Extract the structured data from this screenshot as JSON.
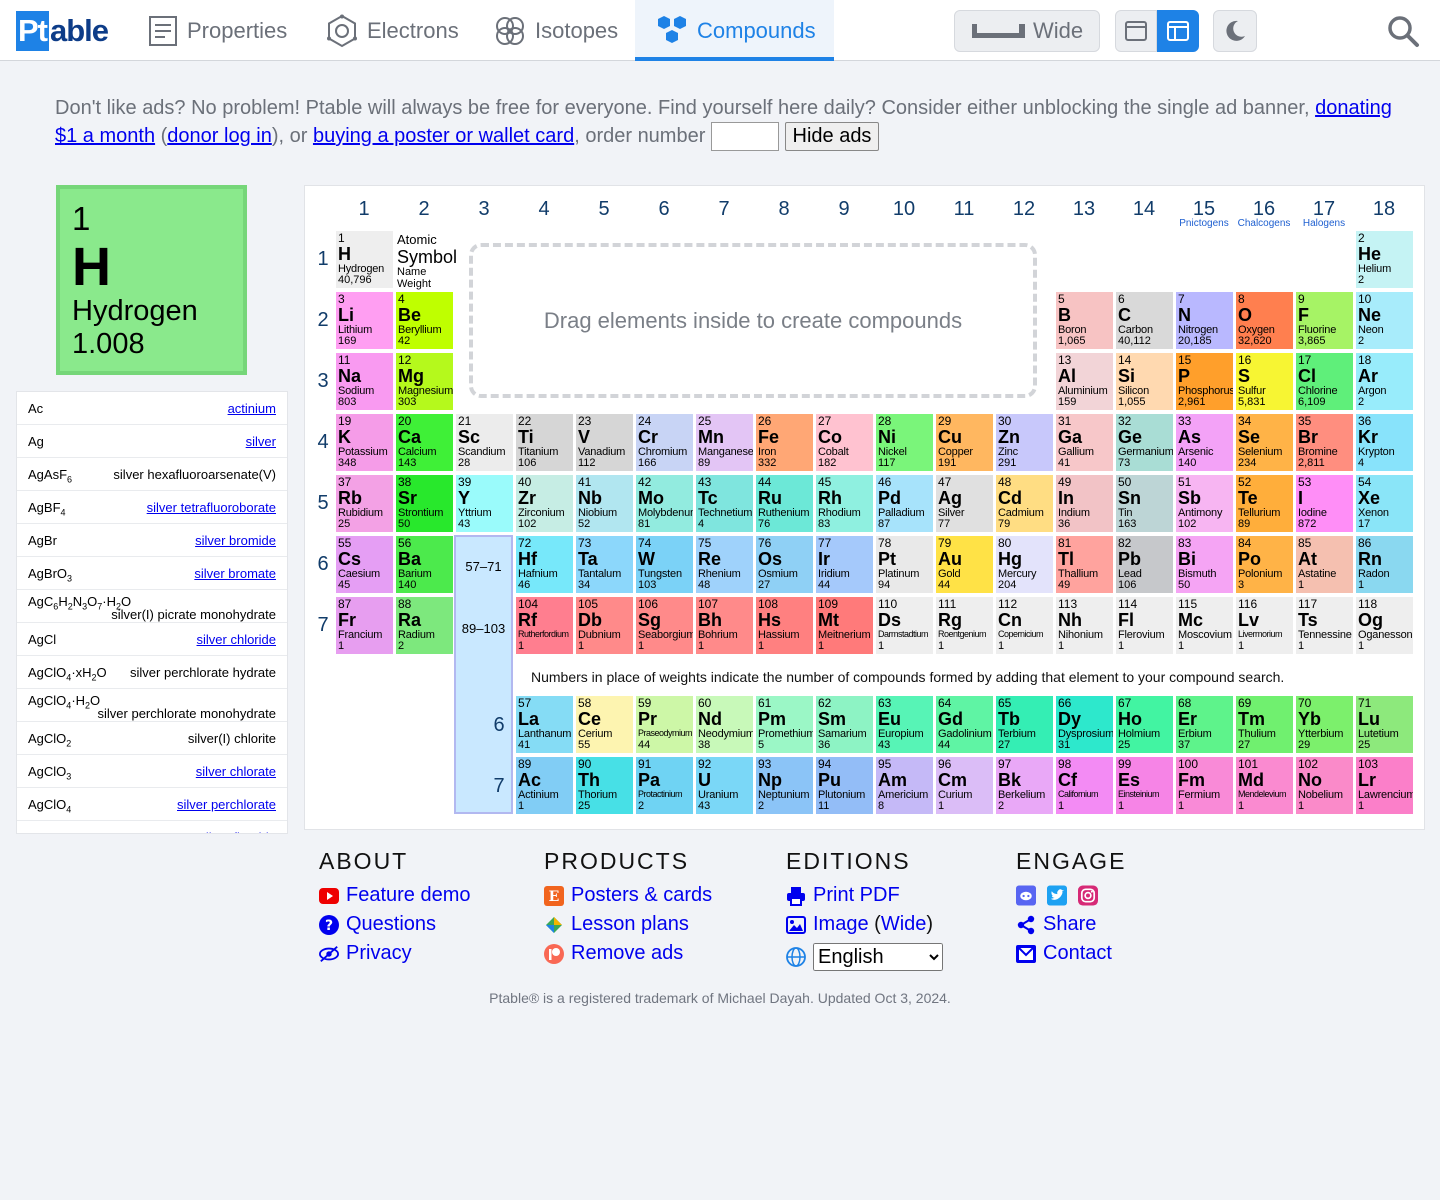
{
  "nav": {
    "logo_a": "Pt",
    "logo_b": "able",
    "tabs": [
      {
        "label": "Properties"
      },
      {
        "label": "Electrons"
      },
      {
        "label": "Isotopes"
      },
      {
        "label": "Compounds"
      }
    ],
    "wide_label": "Wide"
  },
  "ads": {
    "text_a": "Don't like ads? No problem! Ptable will always be free for everyone. Find yourself here daily? Consider either unblocking the single ad banner, ",
    "link_donate": "donating $1 a month",
    "text_b": " (",
    "link_login": "donor log in",
    "text_c": "), or ",
    "link_poster": "buying a poster or wallet card",
    "text_d": ", order number ",
    "hide_label": "Hide ads"
  },
  "selected": {
    "number": "1",
    "symbol": "H",
    "name": "Hydrogen",
    "weight": "1.008"
  },
  "compounds": [
    {
      "formula": "Ac",
      "name": "actinium",
      "link": true
    },
    {
      "formula": "Ag",
      "name": "silver",
      "link": true
    },
    {
      "formula": "AgAsF<sub>6</sub>",
      "name": "silver hexafluoroarsenate(V)",
      "link": false
    },
    {
      "formula": "AgBF<sub>4</sub>",
      "name": "silver tetrafluoroborate",
      "link": true
    },
    {
      "formula": "AgBr",
      "name": "silver bromide",
      "link": true
    },
    {
      "formula": "AgBrO<sub>3</sub>",
      "name": "silver bromate",
      "link": true
    },
    {
      "formula": "AgC<sub>6</sub>H<sub>2</sub>N<sub>3</sub>O<sub>7</sub>·H<sub>2</sub>O",
      "name": "silver(I) picrate monohydrate",
      "link": false,
      "two": true
    },
    {
      "formula": "AgCl",
      "name": "silver chloride",
      "link": true
    },
    {
      "formula": "AgClO<sub>4</sub>·xH<sub>2</sub>O",
      "name": "silver perchlorate hydrate",
      "link": false
    },
    {
      "formula": "AgClO<sub>4</sub>·H<sub>2</sub>O",
      "name": "silver perchlorate monohydrate",
      "link": false,
      "two": true
    },
    {
      "formula": "AgClO<sub>2</sub>",
      "name": "silver(I) chlorite",
      "link": false
    },
    {
      "formula": "AgClO<sub>3</sub>",
      "name": "silver chlorate",
      "link": true
    },
    {
      "formula": "AgClO<sub>4</sub>",
      "name": "silver perchlorate",
      "link": true
    },
    {
      "formula": "AgF",
      "name": "silver fluoride",
      "link": true
    }
  ],
  "table": {
    "groups": [
      "1",
      "2",
      "3",
      "4",
      "5",
      "6",
      "7",
      "8",
      "9",
      "10",
      "11",
      "12",
      "13",
      "14",
      "15",
      "16",
      "17",
      "18"
    ],
    "group_subs": [
      {
        "g": 15,
        "label": "Pnictogens"
      },
      {
        "g": 16,
        "label": "Chalcogens"
      },
      {
        "g": 17,
        "label": "Halogens"
      }
    ],
    "periods": [
      "1",
      "2",
      "3",
      "4",
      "5",
      "6",
      "7"
    ],
    "legend": {
      "a": "Atomic",
      "b": "Symbol",
      "c": "Name",
      "d": "Weight"
    },
    "dropzone": "Drag elements inside to create compounds",
    "lanth_label": "57–71",
    "act_label": "89–103",
    "fblock_periods": [
      "6",
      "7"
    ],
    "note": "Numbers in place of weights indicate the number of compounds formed by adding that element to your compound search.",
    "elements": [
      [
        1,
        "H",
        "Hydrogen",
        "40,796",
        1,
        1,
        "#eeeeee"
      ],
      [
        2,
        "He",
        "Helium",
        "2",
        18,
        1,
        "#c5f3f4"
      ],
      [
        3,
        "Li",
        "Lithium",
        "169",
        1,
        2,
        "#ff9ef2"
      ],
      [
        4,
        "Be",
        "Beryllium",
        "42",
        2,
        2,
        "#bfff00"
      ],
      [
        5,
        "B",
        "Boron",
        "1,065",
        13,
        2,
        "#f7c3c3"
      ],
      [
        6,
        "C",
        "Carbon",
        "40,112",
        14,
        2,
        "#d9d9d9"
      ],
      [
        7,
        "N",
        "Nitrogen",
        "20,185",
        15,
        2,
        "#b9b8ff"
      ],
      [
        8,
        "O",
        "Oxygen",
        "32,620",
        16,
        2,
        "#ff7f4f"
      ],
      [
        9,
        "F",
        "Fluorine",
        "3,865",
        17,
        2,
        "#a6f365"
      ],
      [
        10,
        "Ne",
        "Neon",
        "2",
        18,
        2,
        "#a8ecfb"
      ],
      [
        11,
        "Na",
        "Sodium",
        "803",
        1,
        3,
        "#f99af1"
      ],
      [
        12,
        "Mg",
        "Magnesium",
        "303",
        2,
        3,
        "#b5f91c"
      ],
      [
        13,
        "Al",
        "Aluminium",
        "159",
        13,
        3,
        "#f2d4d7"
      ],
      [
        14,
        "Si",
        "Silicon",
        "1,055",
        14,
        3,
        "#ffd9b0"
      ],
      [
        15,
        "P",
        "Phosphorus",
        "2,961",
        15,
        3,
        "#ff9f2b"
      ],
      [
        16,
        "S",
        "Sulfur",
        "5,831",
        16,
        3,
        "#f7f533"
      ],
      [
        17,
        "Cl",
        "Chlorine",
        "6,109",
        17,
        3,
        "#5fef7a"
      ],
      [
        18,
        "Ar",
        "Argon",
        "2",
        18,
        3,
        "#98ecfb"
      ],
      [
        19,
        "K",
        "Potassium",
        "348",
        1,
        4,
        "#f59ce8"
      ],
      [
        20,
        "Ca",
        "Calcium",
        "143",
        2,
        4,
        "#3ff037"
      ],
      [
        21,
        "Sc",
        "Scandium",
        "28",
        3,
        4,
        "#ececec"
      ],
      [
        22,
        "Ti",
        "Titanium",
        "106",
        4,
        4,
        "#d6d6d6"
      ],
      [
        23,
        "V",
        "Vanadium",
        "112",
        5,
        4,
        "#d6d6d6"
      ],
      [
        24,
        "Cr",
        "Chromium",
        "166",
        6,
        4,
        "#c8d4f5"
      ],
      [
        25,
        "Mn",
        "Manganese",
        "89",
        7,
        4,
        "#e3c5f5"
      ],
      [
        26,
        "Fe",
        "Iron",
        "332",
        8,
        4,
        "#ffa775"
      ],
      [
        27,
        "Co",
        "Cobalt",
        "182",
        9,
        4,
        "#ffc2d0"
      ],
      [
        28,
        "Ni",
        "Nickel",
        "117",
        10,
        4,
        "#7af57a"
      ],
      [
        29,
        "Cu",
        "Copper",
        "191",
        11,
        4,
        "#ffb760"
      ],
      [
        30,
        "Zn",
        "Zinc",
        "291",
        12,
        4,
        "#c8c8fb"
      ],
      [
        31,
        "Ga",
        "Gallium",
        "41",
        13,
        4,
        "#f7c7c9"
      ],
      [
        32,
        "Ge",
        "Germanium",
        "73",
        14,
        4,
        "#a9ddd5"
      ],
      [
        33,
        "As",
        "Arsenic",
        "140",
        15,
        4,
        "#f3a2f7"
      ],
      [
        34,
        "Se",
        "Selenium",
        "234",
        16,
        4,
        "#ffb347"
      ],
      [
        35,
        "Br",
        "Bromine",
        "2,811",
        17,
        4,
        "#ff8e7f"
      ],
      [
        36,
        "Kr",
        "Krypton",
        "4",
        18,
        4,
        "#88e3fb"
      ],
      [
        37,
        "Rb",
        "Rubidium",
        "25",
        1,
        5,
        "#f3a1e5"
      ],
      [
        38,
        "Sr",
        "Strontium",
        "50",
        2,
        5,
        "#28e82c"
      ],
      [
        39,
        "Y",
        "Yttrium",
        "43",
        3,
        5,
        "#9afbfb"
      ],
      [
        40,
        "Zr",
        "Zirconium",
        "102",
        4,
        5,
        "#c6ede4"
      ],
      [
        41,
        "Nb",
        "Niobium",
        "52",
        5,
        5,
        "#b1e6f0"
      ],
      [
        42,
        "Mo",
        "Molybdenum",
        "81",
        6,
        5,
        "#92ebdf"
      ],
      [
        43,
        "Tc",
        "Technetium",
        "4",
        7,
        5,
        "#7fe5de"
      ],
      [
        44,
        "Ru",
        "Ruthenium",
        "76",
        8,
        5,
        "#6ce8d7"
      ],
      [
        45,
        "Rh",
        "Rhodium",
        "83",
        9,
        5,
        "#8ff0e0"
      ],
      [
        46,
        "Pd",
        "Palladium",
        "87",
        10,
        5,
        "#a7e3fb"
      ],
      [
        47,
        "Ag",
        "Silver",
        "77",
        11,
        5,
        "#e0e0e0"
      ],
      [
        48,
        "Cd",
        "Cadmium",
        "79",
        12,
        5,
        "#ffdd83"
      ],
      [
        49,
        "In",
        "Indium",
        "36",
        13,
        5,
        "#f2c3c6"
      ],
      [
        50,
        "Sn",
        "Tin",
        "163",
        14,
        5,
        "#bdd5d6"
      ],
      [
        51,
        "Sb",
        "Antimony",
        "102",
        15,
        5,
        "#f7b5f2"
      ],
      [
        52,
        "Te",
        "Tellurium",
        "89",
        16,
        5,
        "#ffae3b"
      ],
      [
        53,
        "I",
        "Iodine",
        "872",
        17,
        5,
        "#ff8ef7"
      ],
      [
        54,
        "Xe",
        "Xenon",
        "17",
        18,
        5,
        "#8ae5f8"
      ],
      [
        55,
        "Cs",
        "Caesium",
        "45",
        1,
        6,
        "#e59ef4"
      ],
      [
        56,
        "Ba",
        "Barium",
        "140",
        2,
        6,
        "#4cea4c"
      ],
      [
        72,
        "Hf",
        "Hafnium",
        "46",
        4,
        6,
        "#77e8fa"
      ],
      [
        73,
        "Ta",
        "Tantalum",
        "34",
        5,
        6,
        "#8cd7fb"
      ],
      [
        74,
        "W",
        "Tungsten",
        "103",
        6,
        6,
        "#7bd2f7"
      ],
      [
        75,
        "Re",
        "Rhenium",
        "48",
        7,
        6,
        "#9fd2fb"
      ],
      [
        76,
        "Os",
        "Osmium",
        "27",
        8,
        6,
        "#8fd0f5"
      ],
      [
        77,
        "Ir",
        "Iridium",
        "44",
        9,
        6,
        "#a5c9fb"
      ],
      [
        78,
        "Pt",
        "Platinum",
        "94",
        10,
        6,
        "#e9e9e9"
      ],
      [
        79,
        "Au",
        "Gold",
        "44",
        11,
        6,
        "#ffe246"
      ],
      [
        80,
        "Hg",
        "Mercury",
        "204",
        12,
        6,
        "#e3e3fb"
      ],
      [
        81,
        "Tl",
        "Thallium",
        "49",
        13,
        6,
        "#ffa39e"
      ],
      [
        82,
        "Pb",
        "Lead",
        "106",
        14,
        6,
        "#c6c8cb"
      ],
      [
        83,
        "Bi",
        "Bismuth",
        "50",
        15,
        6,
        "#f5a4f4"
      ],
      [
        84,
        "Po",
        "Polonium",
        "3",
        16,
        6,
        "#ffb347"
      ],
      [
        85,
        "At",
        "Astatine",
        "1",
        17,
        6,
        "#f5c0b0"
      ],
      [
        86,
        "Rn",
        "Radon",
        "1",
        18,
        6,
        "#8ad8f0"
      ],
      [
        87,
        "Fr",
        "Francium",
        "1",
        1,
        7,
        "#e79ef0"
      ],
      [
        88,
        "Ra",
        "Radium",
        "2",
        2,
        7,
        "#7de87d"
      ],
      [
        104,
        "Rf",
        "Rutherfordium",
        "1",
        4,
        7,
        "#ff7e8f"
      ],
      [
        105,
        "Db",
        "Dubnium",
        "1",
        5,
        7,
        "#ff8a8a"
      ],
      [
        106,
        "Sg",
        "Seaborgium",
        "1",
        6,
        7,
        "#ff8a8a"
      ],
      [
        107,
        "Bh",
        "Bohrium",
        "1",
        7,
        7,
        "#ff8a8a"
      ],
      [
        108,
        "Hs",
        "Hassium",
        "1",
        8,
        7,
        "#ff8080"
      ],
      [
        109,
        "Mt",
        "Meitnerium",
        "1",
        9,
        7,
        "#ff7a7a"
      ],
      [
        110,
        "Ds",
        "Darmstadtium",
        "1",
        10,
        7,
        "#eeeeee"
      ],
      [
        111,
        "Rg",
        "Roentgenium",
        "1",
        11,
        7,
        "#eeeeee"
      ],
      [
        112,
        "Cn",
        "Copernicium",
        "1",
        12,
        7,
        "#eeeeee"
      ],
      [
        113,
        "Nh",
        "Nihonium",
        "1",
        13,
        7,
        "#eeeeee"
      ],
      [
        114,
        "Fl",
        "Flerovium",
        "1",
        14,
        7,
        "#eeeeee"
      ],
      [
        115,
        "Mc",
        "Moscovium",
        "1",
        15,
        7,
        "#eeeeee"
      ],
      [
        116,
        "Lv",
        "Livermorium",
        "1",
        16,
        7,
        "#eeeeee"
      ],
      [
        117,
        "Ts",
        "Tennessine",
        "1",
        17,
        7,
        "#eeeeee"
      ],
      [
        118,
        "Og",
        "Oganesson",
        "1",
        18,
        7,
        "#eeeeee"
      ],
      [
        57,
        "La",
        "Lanthanum",
        "41",
        4,
        9,
        "#85dcf5"
      ],
      [
        58,
        "Ce",
        "Cerium",
        "55",
        5,
        9,
        "#fdf4b0"
      ],
      [
        59,
        "Pr",
        "Praseodymium",
        "44",
        6,
        9,
        "#cdf7a7"
      ],
      [
        60,
        "Nd",
        "Neodymium",
        "38",
        7,
        9,
        "#c8f9b9"
      ],
      [
        61,
        "Pm",
        "Promethium",
        "5",
        8,
        9,
        "#9bf7c6"
      ],
      [
        62,
        "Sm",
        "Samarium",
        "36",
        9,
        9,
        "#8df3c4"
      ],
      [
        63,
        "Eu",
        "Europium",
        "43",
        10,
        9,
        "#57f4b6"
      ],
      [
        64,
        "Gd",
        "Gadolinium",
        "44",
        11,
        9,
        "#5ff4a4"
      ],
      [
        65,
        "Tb",
        "Terbium",
        "27",
        12,
        9,
        "#34eeb4"
      ],
      [
        66,
        "Dy",
        "Dysprosium",
        "31",
        13,
        9,
        "#2de8cc"
      ],
      [
        67,
        "Ho",
        "Holmium",
        "25",
        14,
        9,
        "#42f4a2"
      ],
      [
        68,
        "Er",
        "Erbium",
        "37",
        15,
        9,
        "#5ef38b"
      ],
      [
        69,
        "Tm",
        "Thulium",
        "27",
        16,
        9,
        "#70f06f"
      ],
      [
        70,
        "Yb",
        "Ytterbium",
        "29",
        17,
        9,
        "#7cf06c"
      ],
      [
        71,
        "Lu",
        "Lutetium",
        "25",
        18,
        9,
        "#8de97c"
      ],
      [
        89,
        "Ac",
        "Actinium",
        "1",
        4,
        10,
        "#81cdf5"
      ],
      [
        90,
        "Th",
        "Thorium",
        "25",
        5,
        10,
        "#47e0e6"
      ],
      [
        91,
        "Pa",
        "Protactinium",
        "2",
        6,
        10,
        "#6fd3f3"
      ],
      [
        92,
        "U",
        "Uranium",
        "43",
        7,
        10,
        "#7ad7f7"
      ],
      [
        93,
        "Np",
        "Neptunium",
        "2",
        8,
        10,
        "#8bc4f7"
      ],
      [
        94,
        "Pu",
        "Plutonium",
        "11",
        9,
        10,
        "#93bdf7"
      ],
      [
        95,
        "Am",
        "Americium",
        "8",
        10,
        10,
        "#c5b9f7"
      ],
      [
        96,
        "Cm",
        "Curium",
        "1",
        11,
        10,
        "#dbbdf7"
      ],
      [
        97,
        "Bk",
        "Berkelium",
        "2",
        12,
        10,
        "#e9a8f7"
      ],
      [
        98,
        "Cf",
        "Californium",
        "1",
        13,
        10,
        "#f38bf4"
      ],
      [
        99,
        "Es",
        "Einsteinium",
        "1",
        14,
        10,
        "#f684e6"
      ],
      [
        100,
        "Fm",
        "Fermium",
        "1",
        15,
        10,
        "#f98ad7"
      ],
      [
        101,
        "Md",
        "Mendelevium",
        "1",
        16,
        10,
        "#fa8ad0"
      ],
      [
        102,
        "No",
        "Nobelium",
        "1",
        17,
        10,
        "#fa8ac9"
      ],
      [
        103,
        "Lr",
        "Lawrencium",
        "1",
        18,
        10,
        "#fb7fc9"
      ]
    ]
  },
  "footer": {
    "about": {
      "title": "ABOUT",
      "items": [
        "Feature demo",
        "Questions",
        "Privacy"
      ]
    },
    "products": {
      "title": "PRODUCTS",
      "items": [
        "Posters & cards",
        "Lesson plans",
        "Remove ads"
      ]
    },
    "editions": {
      "title": "EDITIONS",
      "print": "Print PDF",
      "image_a": "Image",
      "image_b": "Wide",
      "language": "English"
    },
    "engage": {
      "title": "ENGAGE",
      "share": "Share",
      "contact": "Contact"
    },
    "copyright": "Ptable® is a registered trademark of Michael Dayah. Updated Oct 3, 2024."
  }
}
